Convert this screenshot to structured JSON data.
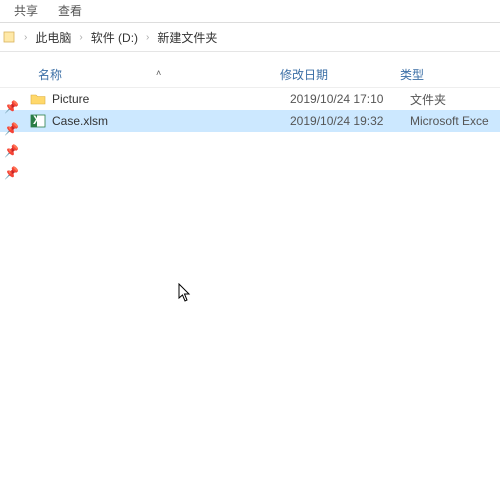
{
  "ribbon": {
    "tab_share": "共享",
    "tab_view": "查看"
  },
  "breadcrumb": {
    "root": "此电脑",
    "drive": "软件 (D:)",
    "folder": "新建文件夹"
  },
  "columns": {
    "name": "名称",
    "date": "修改日期",
    "type": "类型"
  },
  "files": [
    {
      "name": "Picture",
      "date": "2019/10/24 17:10",
      "type": "文件夹",
      "kind": "folder"
    },
    {
      "name": "Case.xlsm",
      "date": "2019/10/24 19:32",
      "type": "Microsoft Exce",
      "kind": "excel"
    }
  ]
}
